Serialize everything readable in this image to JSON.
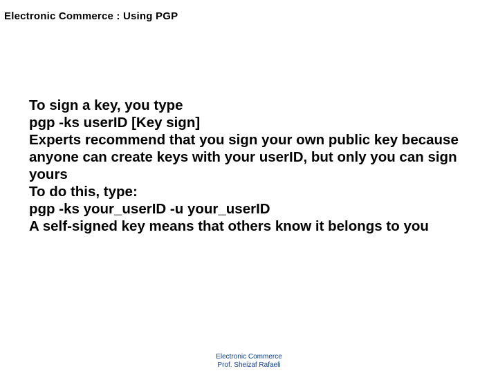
{
  "header": {
    "title": "Electronic Commerce :  Using PGP"
  },
  "body": {
    "line1": "To sign a key, you type",
    "line2": "pgp -ks userID  [Key sign]",
    "line3": "Experts recommend that you sign your own public key because anyone can create keys with your  userID, but only you can sign yours",
    "line4": "To do this, type:",
    "line5": "pgp -ks your_userID -u your_userID",
    "line6": "A self-signed key means that others know it belongs to you"
  },
  "footer": {
    "line1": "Electronic Commerce",
    "line2": "Prof. Sheizaf Rafaeli"
  }
}
